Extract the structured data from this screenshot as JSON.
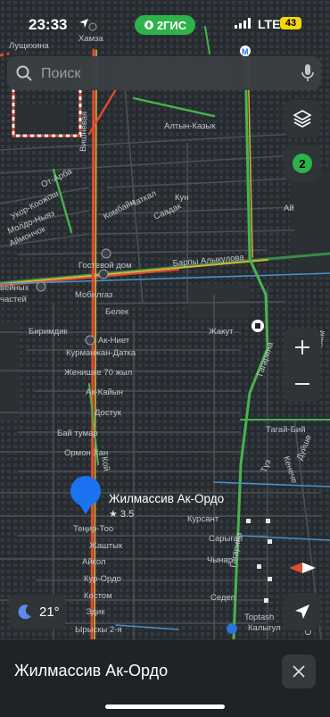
{
  "status_bar": {
    "time": "23:33",
    "brand": "2ГИС",
    "network": "LTE",
    "battery": "43"
  },
  "search": {
    "placeholder": "Поиск"
  },
  "controls": {
    "traffic_badge": "2",
    "weather_temp": "21°"
  },
  "map_labels": {
    "lushchikhina": "Лущихина",
    "hamza": "Хамза",
    "altyn_kazyk": "Алтын-Казык",
    "ot_arba": "От-Арба",
    "ukor": "Укор-Коожош",
    "moldo_nias": "Молдо-Ныяз",
    "aymonchok": "Аймончок",
    "vishnevaya": "Вишневая",
    "kombayn": "Комбайн",
    "chatkal": "Чаткал",
    "saadak": "Саадак",
    "kun": "Кун",
    "ay": "Ай",
    "gostevoy_dom": "Гостевой дом",
    "mobilgaz": "Мобилгаз",
    "barpy": "Барпы Алыкулова",
    "veynyh": "вейных",
    "chastey": "частей",
    "belek": "Белек",
    "birimdik": "Биримдик",
    "ak_niet": "Ак-Ниет",
    "kurmanjan": "Курманжан-Датка",
    "jakut": "Жакут",
    "jenishke": "Женишке 70 жыл",
    "ak_kayyn": "Ак-Кайын",
    "dostuk": "Достук",
    "gagarina": "Гагарина",
    "tagay_biy": "Тагай-Бий",
    "bay_tumar": "Бай тумар",
    "ormon_han": "Ормон Хан",
    "koy": "Кой",
    "keneche": "Кенече",
    "duyshe": "Дүйшө",
    "tuz": "Түз",
    "komm": "Комм",
    "kursant": "Курсант",
    "sarygap": "Сарыгап",
    "chynar": "Чынар",
    "tenir_too": "Теңир-Тоо",
    "jashtyk": "Жаштык",
    "aykol": "Айкол",
    "kur_ordo": "Кур-Ордо",
    "kostom": "Костом",
    "edik": "Эдик",
    "sedep": "Седеп",
    "toptash": "Toptash",
    "kalygul": "Калыгул",
    "ryskyl": "Ырыскы 2-я",
    "sad": "Сад"
  },
  "selected_place": {
    "name": "Жилмассив Ак-Ордо",
    "rating": "★ 3.5"
  },
  "sheet": {
    "title": "Жилмассив Ак-Ордо"
  },
  "colors": {
    "accent": "#2db34a",
    "pin": "#1b73f2",
    "traffic_red": "#e34a2f",
    "traffic_green": "#49b34d",
    "traffic_yellow": "#d8b43a"
  }
}
